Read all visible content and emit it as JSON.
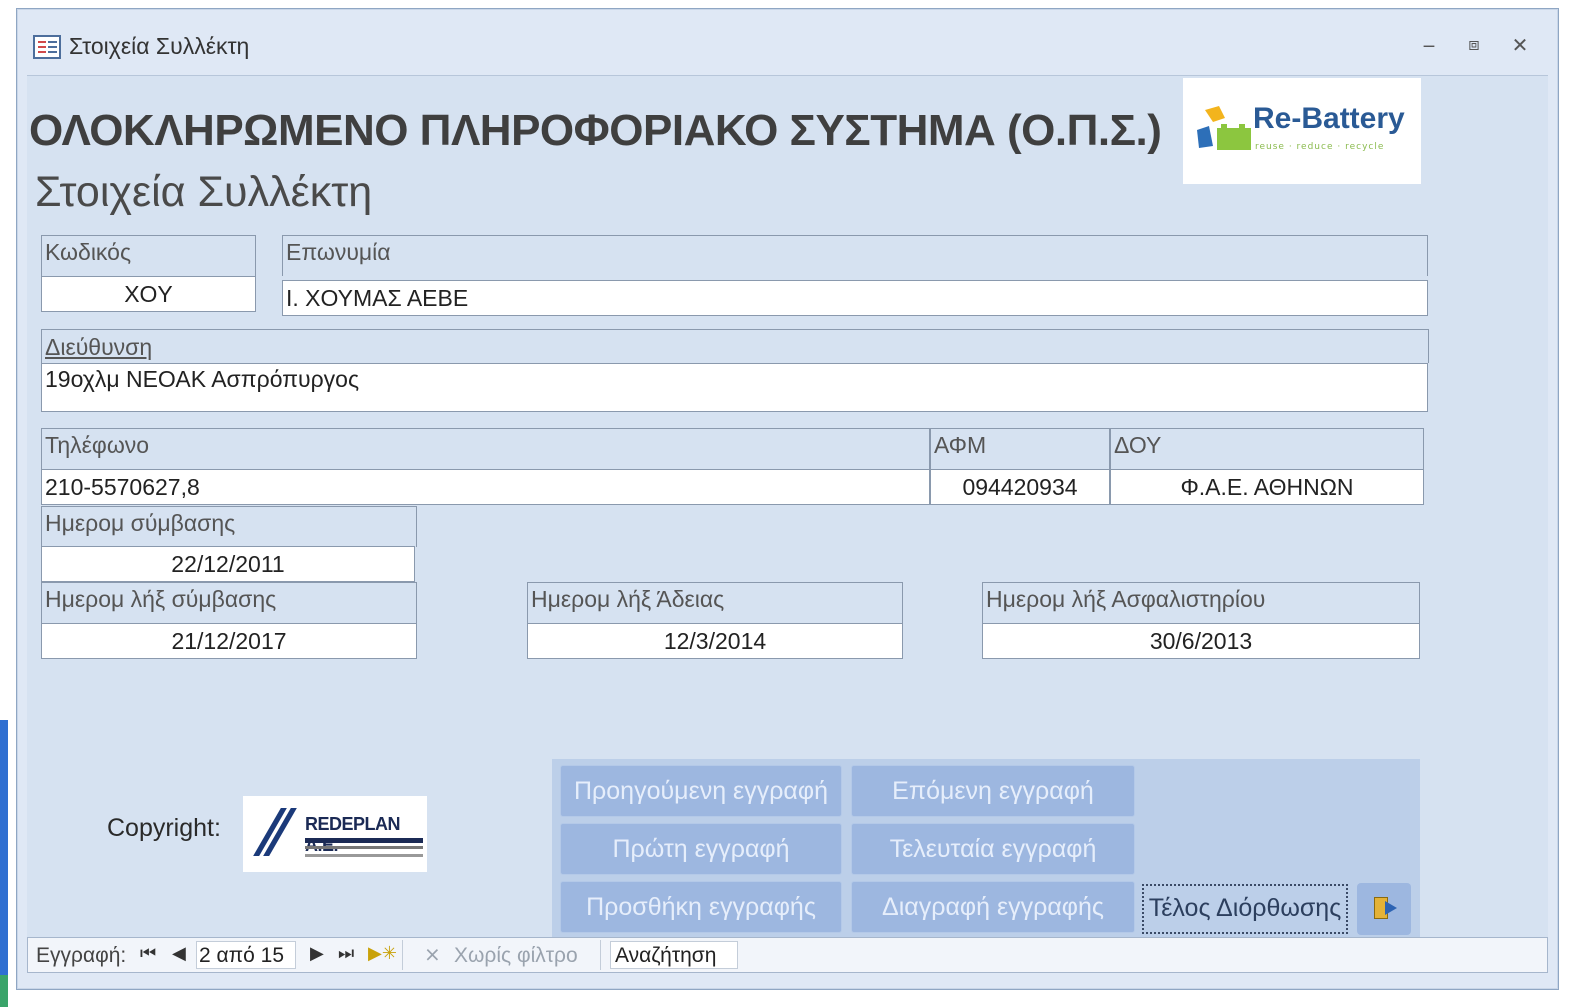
{
  "window": {
    "title": "Στοιχεία Συλλέκτη",
    "minimize_icon": "minimize-icon",
    "restore_icon": "restore-icon",
    "close_icon": "close-icon"
  },
  "header": {
    "heading": "ΟΛΟΚΛΗΡΩΜΕΝΟ ΠΛΗΡΟΦΟΡΙΑΚΟ ΣΥΣΤΗΜΑ (Ο.Π.Σ.)",
    "subheading": "Στοιχεία Συλλέκτη",
    "logo_text": "Re-Battery",
    "logo_tagline": "reuse · reduce · recycle"
  },
  "fields": {
    "code": {
      "label": "Κωδικός",
      "value": "XOY"
    },
    "name": {
      "label": "Επωνυμία",
      "value": "Ι. ΧΟΥΜΑΣ ΑΕΒΕ"
    },
    "address": {
      "label": "Διεύθυνση",
      "value": "19οχλμ ΝΕΟΑΚ Ασπρόπυργος"
    },
    "phone": {
      "label": "Τηλέφωνο",
      "value": "210-5570627,8"
    },
    "afm": {
      "label": "ΑΦΜ",
      "value": "094420934"
    },
    "doy": {
      "label": "ΔΟΥ",
      "value": "Φ.Α.Ε. ΑΘΗΝΩΝ"
    },
    "contract_date": {
      "label": "Ημερομ σύμβασης",
      "value": "22/12/2011"
    },
    "contract_end": {
      "label": "Ημερομ λήξ σύμβασης",
      "value": "21/12/2017"
    },
    "license_end": {
      "label": "Ημερομ λήξ Άδειας",
      "value": "12/3/2014"
    },
    "insurance_end": {
      "label": "Ημερομ λήξ Ασφαλιστηρίου",
      "value": "30/6/2013"
    }
  },
  "commands": {
    "prev": "Προηγούμενη εγγραφή",
    "next": "Επόμενη εγγραφή",
    "first": "Πρώτη εγγραφή",
    "last": "Τελευταία εγγραφή",
    "add": "Προσθήκη εγγραφής",
    "delete": "Διαγραφή εγγραφής",
    "end_edit": "Τέλος Διόρθωσης",
    "exit_icon": "exit-door-icon"
  },
  "footer": {
    "copyright_label": "Copyright:",
    "company_logo": "REDEPLAN A.E."
  },
  "navbar": {
    "record_label": "Εγγραφή:",
    "position": "2 από 15",
    "filter_label": "Χωρίς φίλτρο",
    "search_placeholder": "Αναζήτηση"
  }
}
